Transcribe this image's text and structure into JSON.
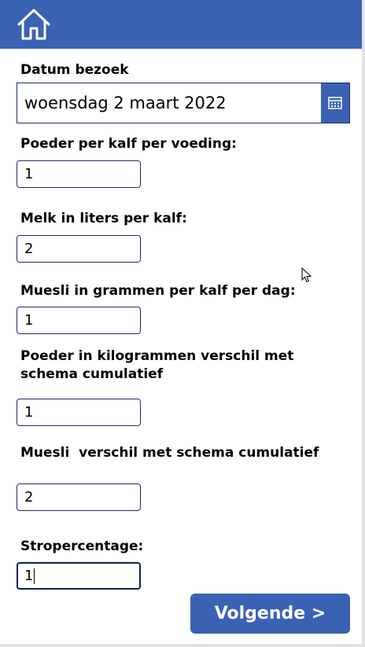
{
  "header": {
    "home_icon": "home-icon",
    "background_color": "#3a62b4"
  },
  "form": {
    "date": {
      "label": "Datum bezoek",
      "value": "woensdag 2 maart 2022",
      "picker_icon": "calendar-icon"
    },
    "powder_per_calf": {
      "label": "Poeder per kalf per voeding:",
      "value": "1"
    },
    "milk_liters": {
      "label": "Melk in liters per kalf:",
      "value": "2"
    },
    "muesli_grams": {
      "label": "Muesli in grammen per kalf per dag:",
      "value": "1"
    },
    "powder_difference": {
      "label": "Poeder in kilogrammen verschil met schema cumulatief",
      "value": "1"
    },
    "muesli_difference": {
      "label": "Muesli  verschil met schema cumulatief",
      "value": "2"
    },
    "straw_percentage": {
      "label": "Stropercentage:",
      "value": "1"
    }
  },
  "actions": {
    "next_label": "Volgende >"
  },
  "colors": {
    "accent": "#3a62b4",
    "field_border": "#1f2d6b"
  }
}
